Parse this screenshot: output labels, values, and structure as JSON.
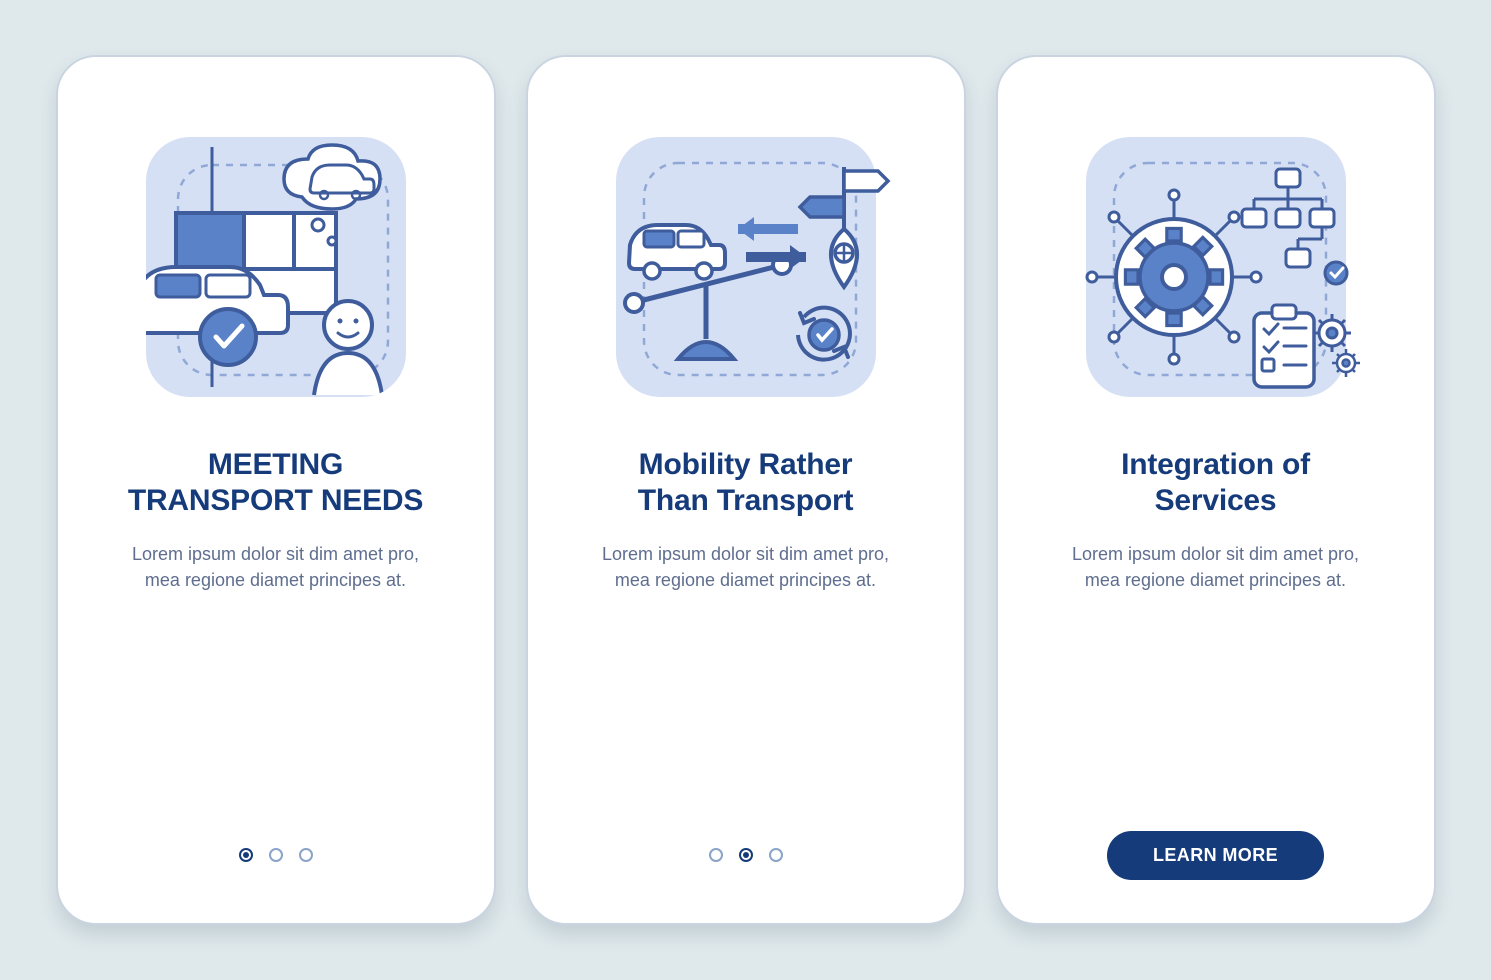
{
  "colors": {
    "bg": "#dfe9ec",
    "card": "#ffffff",
    "primary_dark": "#163b7a",
    "primary_mid": "#5a82c9",
    "primary_light": "#c6d4f2",
    "illus_bg": "#d6e0f5",
    "text_muted": "#5f6e8f"
  },
  "screens": [
    {
      "icon_name": "transport-needs-icon",
      "title": "MEETING\nTRANSPORT NEEDS",
      "description": "Lorem ipsum dolor sit dim amet pro, mea regione diamet principes at.",
      "pagination": {
        "total": 3,
        "active_index": 0
      },
      "cta": null
    },
    {
      "icon_name": "mobility-icon",
      "title": "Mobility Rather\nThan Transport",
      "description": "Lorem ipsum dolor sit dim amet pro, mea regione diamet principes at.",
      "pagination": {
        "total": 3,
        "active_index": 1
      },
      "cta": null
    },
    {
      "icon_name": "integration-icon",
      "title": "Integration of\nServices",
      "description": "Lorem ipsum dolor sit dim amet pro, mea regione diamet principes at.",
      "pagination": null,
      "cta": "LEARN MORE"
    }
  ]
}
